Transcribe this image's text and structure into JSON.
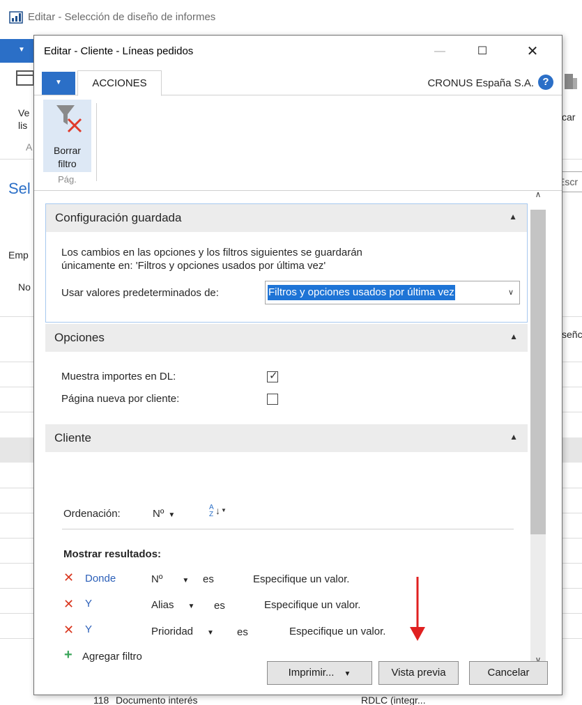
{
  "background": {
    "window_title": "Editar - Selección de diseño de informes",
    "fragments": [
      "Ve",
      "lis",
      "A",
      "Sel",
      "Emp",
      "No",
      "car",
      "señc",
      "Escr"
    ],
    "bottom_row": {
      "id": "118",
      "description": "Documento interés",
      "layout": "RDLC (integr..."
    }
  },
  "dialog": {
    "title": "Editar - Cliente - Líneas pedidos",
    "ribbon": {
      "actions_tab": "ACCIONES",
      "company": "CRONUS España S.A.",
      "help": "?",
      "clear_filter_line1": "Borrar",
      "clear_filter_line2": "filtro",
      "group_label": "Pág."
    },
    "saved_settings": {
      "header": "Configuración guardada",
      "message_line1": "Los cambios en las opciones y los filtros siguientes se guardarán",
      "message_line2": "únicamente en: 'Filtros y opciones usados por última vez'",
      "defaults_label": "Usar valores predeterminados de:",
      "defaults_value": "Filtros y opciones usados por última vez"
    },
    "options": {
      "header": "Opciones",
      "show_lcy_label": "Muestra importes en DL:",
      "show_lcy_checked": true,
      "new_page_label": "Página nueva por cliente:",
      "new_page_checked": false
    },
    "customer": {
      "header": "Cliente",
      "sort_label": "Ordenación:",
      "sort_field": "Nº",
      "show_results": "Mostrar resultados:",
      "filters": [
        {
          "conj": "Donde",
          "field": "Nº",
          "op": "es",
          "value": "Especifique un valor."
        },
        {
          "conj": "Y",
          "field": "Alias",
          "op": "es",
          "value": "Especifique un valor."
        },
        {
          "conj": "Y",
          "field": "Prioridad",
          "op": "es",
          "value": "Especifique un valor."
        }
      ],
      "add_filter": "Agregar filtro"
    },
    "buttons": {
      "print": "Imprimir...",
      "preview": "Vista previa",
      "cancel": "Cancelar"
    }
  },
  "colors": {
    "accent": "#2b6fc7",
    "annotation_arrow": "#e02020",
    "delete_x": "#d9361e",
    "add_plus": "#3aa55a"
  }
}
